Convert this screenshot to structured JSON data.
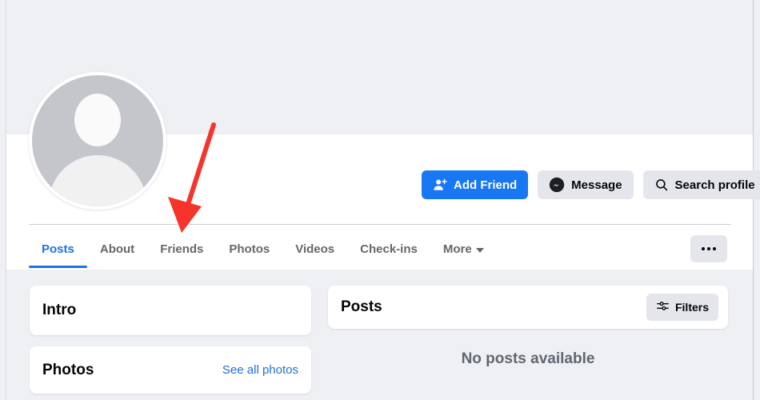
{
  "profile": {
    "avatar_alt": "default-profile-placeholder"
  },
  "actions": [
    {
      "label": "Add Friend",
      "icon": "person-add-icon",
      "style": "primary"
    },
    {
      "label": "Message",
      "icon": "messenger-icon",
      "style": "secondary"
    },
    {
      "label": "Search profile",
      "icon": "search-icon",
      "style": "secondary"
    }
  ],
  "tabs": [
    {
      "label": "Posts",
      "active": true,
      "caret": false
    },
    {
      "label": "About",
      "active": false,
      "caret": false
    },
    {
      "label": "Friends",
      "active": false,
      "caret": false
    },
    {
      "label": "Photos",
      "active": false,
      "caret": false
    },
    {
      "label": "Videos",
      "active": false,
      "caret": false
    },
    {
      "label": "Check-ins",
      "active": false,
      "caret": false
    },
    {
      "label": "More",
      "active": false,
      "caret": true
    }
  ],
  "more_menu": {
    "label": "more-options"
  },
  "left_column": {
    "intro": {
      "title": "Intro"
    },
    "photos": {
      "title": "Photos",
      "link": "See all photos"
    }
  },
  "right_column": {
    "posts": {
      "title": "Posts",
      "filters_label": "Filters"
    },
    "empty_state": "No posts available"
  },
  "annotation": {
    "type": "red-arrow",
    "points_to": "Friends",
    "color": "#f5352b"
  },
  "colors": {
    "background": "#eff0f4",
    "surface": "#ffffff",
    "accent": "#1877f2",
    "tab_active": "#1b74e4",
    "link": "#216fdb",
    "muted_text": "#65676b",
    "button_secondary": "#e4e6eb"
  }
}
